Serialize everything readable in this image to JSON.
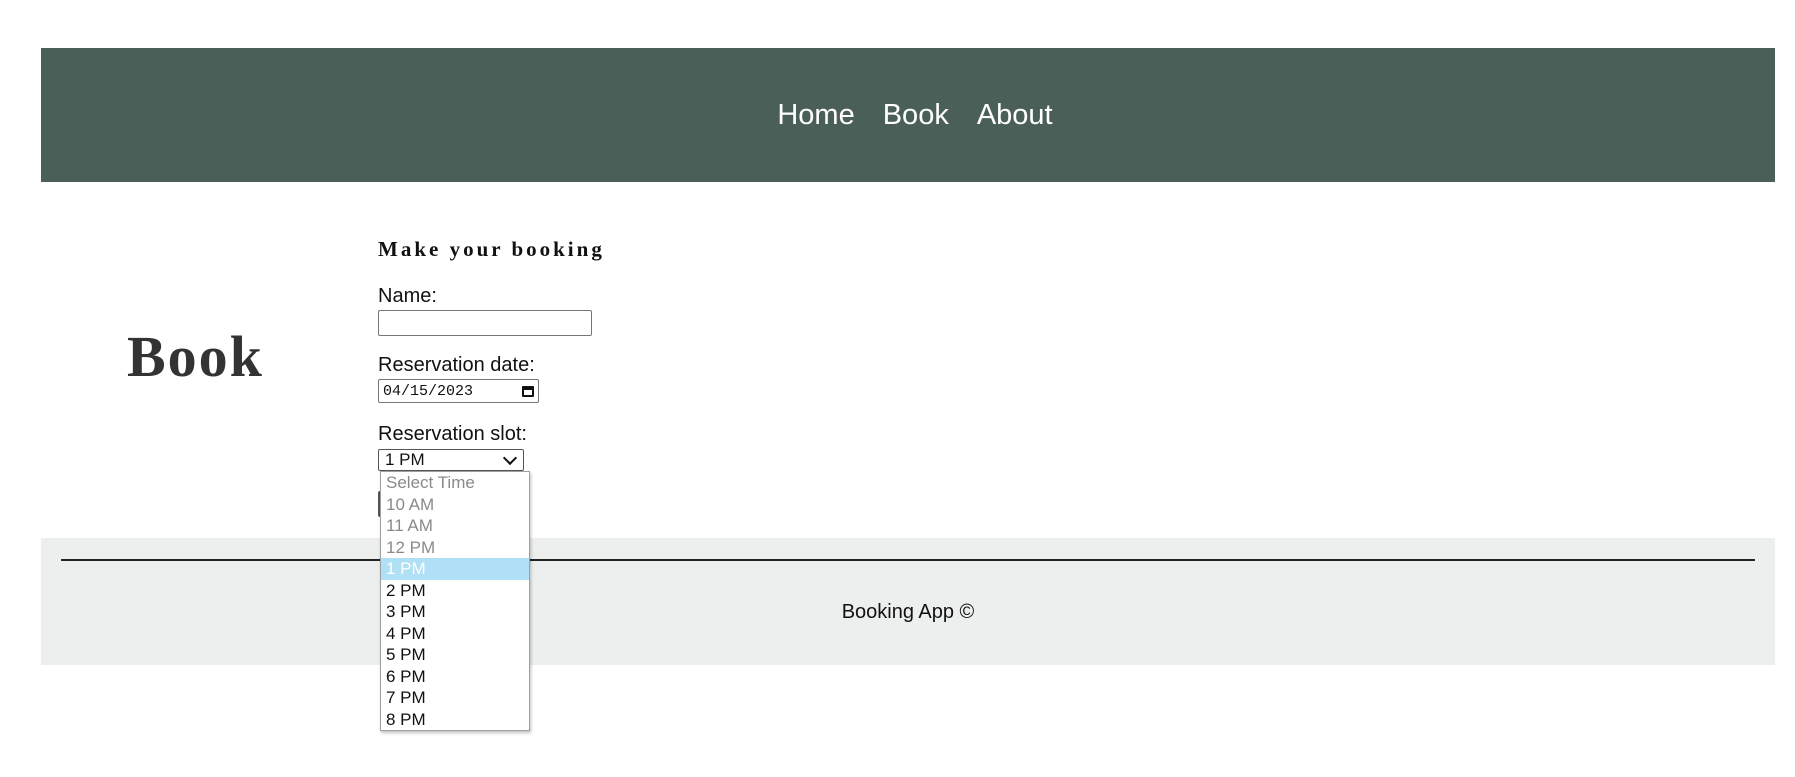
{
  "header": {
    "nav": [
      "Home",
      "Book",
      "About"
    ]
  },
  "main": {
    "title": "Book",
    "form": {
      "heading": "Make your booking",
      "name_label": "Name:",
      "name_value": "",
      "date_label": "Reservation date:",
      "date_value": "04/15/2023",
      "slot_label": "Reservation slot:",
      "slot_value": "1 PM",
      "slot_options": [
        {
          "label": "Select Time",
          "disabled": true
        },
        {
          "label": "10 AM",
          "disabled": true
        },
        {
          "label": "11 AM",
          "disabled": true
        },
        {
          "label": "12 PM",
          "disabled": true
        },
        {
          "label": "1 PM",
          "selected": true
        },
        {
          "label": "2 PM"
        },
        {
          "label": "3 PM"
        },
        {
          "label": "4 PM"
        },
        {
          "label": "5 PM"
        },
        {
          "label": "6 PM"
        },
        {
          "label": "7 PM"
        },
        {
          "label": "8 PM"
        }
      ]
    }
  },
  "footer": {
    "text": "Booking App ©"
  },
  "colors": {
    "header_bg": "#4a5f58",
    "footer_bg": "#edefee",
    "selected_option_bg": "#b0e0f5"
  }
}
